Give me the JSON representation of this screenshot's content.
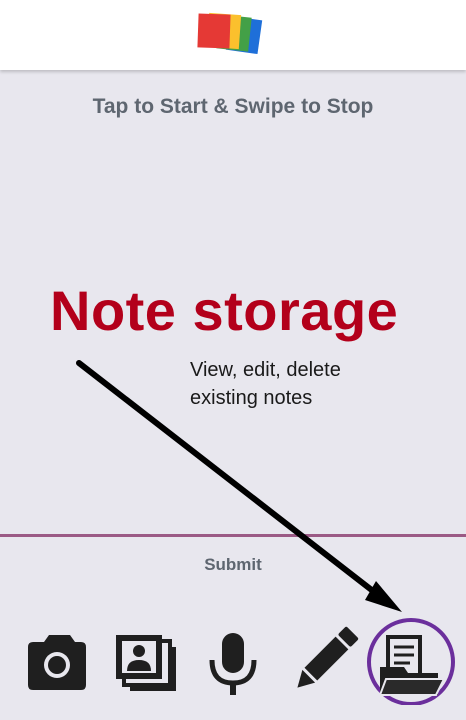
{
  "header": {
    "logo_icon": "stacked-color-squares-logo",
    "logo_colors": [
      "#e53935",
      "#fbc02d",
      "#43a047",
      "#1e6fd9"
    ]
  },
  "main": {
    "instruction": "Tap to Start & Swipe to Stop"
  },
  "annotation": {
    "title": "Note storage",
    "description_line1": "View, edit, delete",
    "description_line2": "existing notes",
    "title_color": "#b3001b",
    "highlight_color": "#6b2f9c"
  },
  "form": {
    "submit_label": "Submit"
  },
  "toolbar": {
    "items": [
      {
        "icon": "camera-icon"
      },
      {
        "icon": "photo-gallery-icon"
      },
      {
        "icon": "microphone-icon"
      },
      {
        "icon": "pencil-icon"
      },
      {
        "icon": "notes-folder-icon",
        "highlighted": true
      }
    ]
  }
}
